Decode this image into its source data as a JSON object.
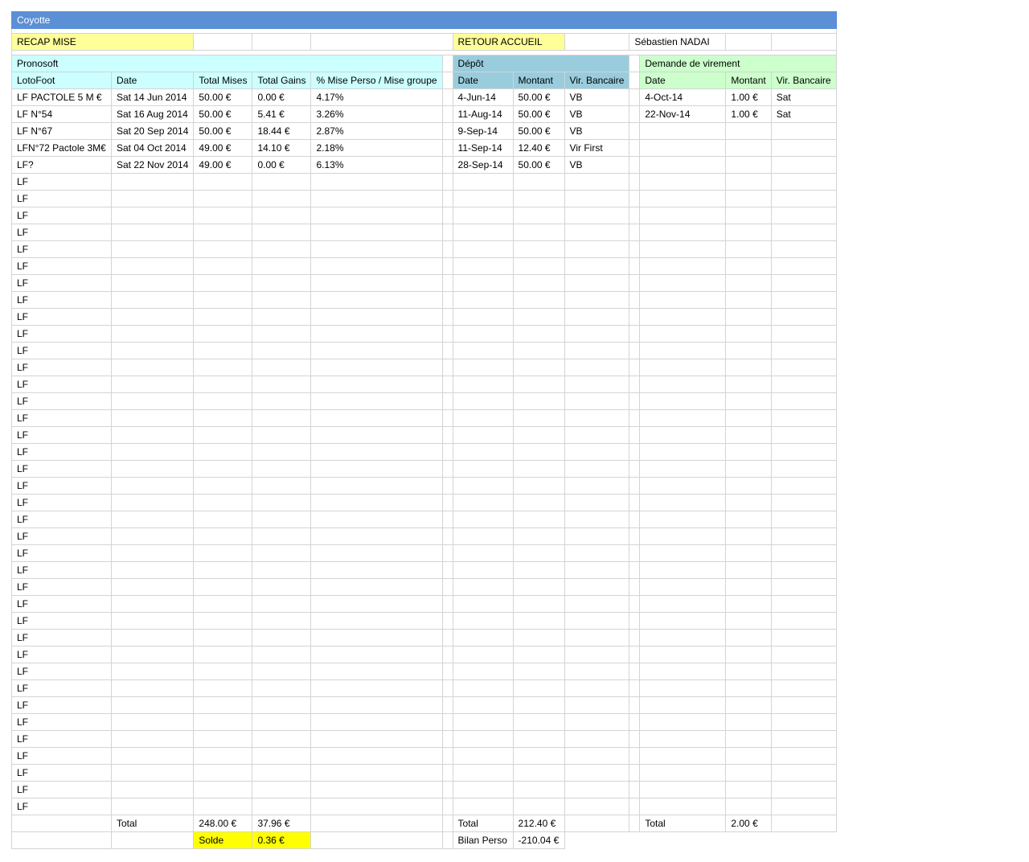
{
  "sheet": {
    "title": "Coyotte",
    "recap_label": "RECAP MISE",
    "retour_label": "RETOUR ACCUEIL",
    "user_name": "Sébastien NADAI"
  },
  "colors": {
    "title_bar": "#5b8fd6",
    "recap": "#ffff99",
    "pronosoft": "#ccffff",
    "depot": "#99ccdd",
    "virement": "#ccffcc",
    "solde": "#ffff00"
  },
  "pronosoft": {
    "title": "Pronosoft",
    "headers": [
      "LotoFoot",
      "Date",
      "Total Mises",
      "Total Gains",
      "% Mise Perso / Mise groupe"
    ],
    "rows": [
      [
        "LF PACTOLE 5 M €",
        "Sat 14 Jun 2014",
        "50.00 €",
        "0.00 €",
        "4.17%"
      ],
      [
        "LF N°54",
        "Sat 16 Aug 2014",
        "50.00 €",
        "5.41 €",
        "3.26%"
      ],
      [
        "LF N°67",
        "Sat 20 Sep 2014",
        "50.00 €",
        "18.44 €",
        "2.87%"
      ],
      [
        "LFN°72 Pactole 3M€",
        "Sat 04 Oct 2014",
        "49.00 €",
        "14.10 €",
        "2.18%"
      ],
      [
        "LF?",
        "Sat 22 Nov 2014",
        "49.00 €",
        "0.00 €",
        "6.13%"
      ]
    ],
    "placeholder_label": "LF",
    "placeholder_count": 38,
    "total_label": "Total",
    "total_mises": "248.00 €",
    "total_gains": "37.96 €",
    "solde_label": "Solde",
    "solde_value": "0.36 €"
  },
  "depot": {
    "title": "Dépôt",
    "headers": [
      "Date",
      "Montant",
      "Vir. Bancaire"
    ],
    "rows": [
      [
        "4-Jun-14",
        "50.00 €",
        "VB"
      ],
      [
        "11-Aug-14",
        "50.00 €",
        "VB"
      ],
      [
        "9-Sep-14",
        "50.00 €",
        "VB"
      ],
      [
        "11-Sep-14",
        "12.40 €",
        "Vir First"
      ],
      [
        "28-Sep-14",
        "50.00 €",
        "VB"
      ]
    ],
    "total_label": "Total",
    "total_value": "212.40 €",
    "bilan_label": "Bilan Perso",
    "bilan_value": "-210.04 €"
  },
  "virement": {
    "title": "Demande de virement",
    "headers": [
      "Date",
      "Montant",
      "Vir. Bancaire"
    ],
    "rows": [
      [
        "4-Oct-14",
        "1.00 €",
        "Sat"
      ],
      [
        "22-Nov-14",
        "1.00 €",
        "Sat"
      ]
    ],
    "total_label": "Total",
    "total_value": "2.00 €"
  }
}
